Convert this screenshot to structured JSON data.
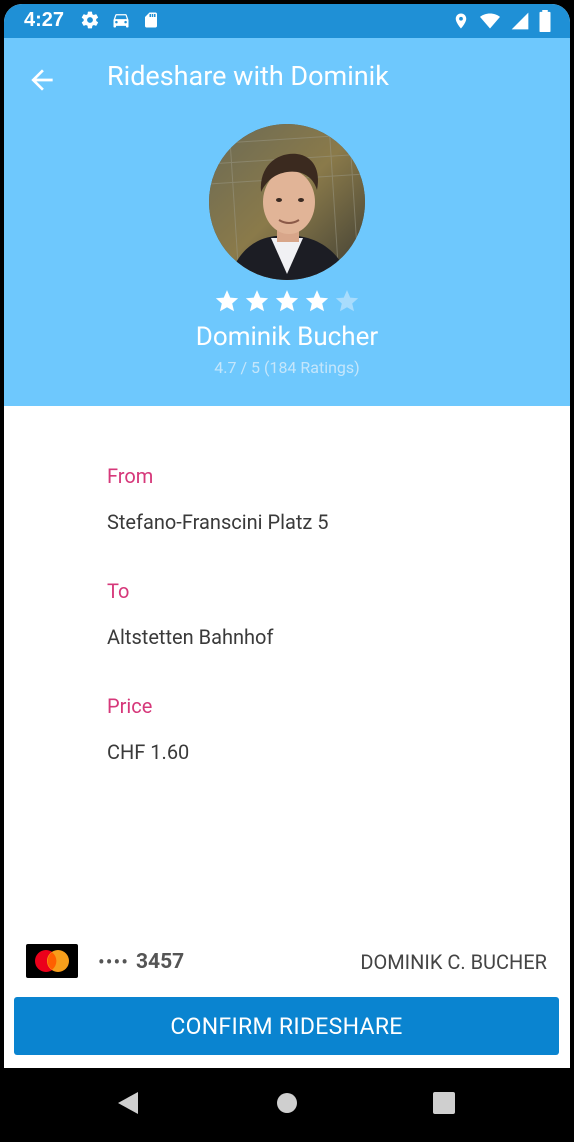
{
  "status_bar": {
    "time": "4:27",
    "icons_left": [
      "settings-icon",
      "car-icon",
      "sd-card-icon"
    ],
    "icons_right": [
      "location-icon",
      "wifi-icon",
      "signal-icon",
      "battery-icon"
    ]
  },
  "app_bar": {
    "title": "Rideshare with Dominik",
    "back_icon": "arrow-back-icon"
  },
  "driver": {
    "name": "Dominik Bucher",
    "rating_stars": 4.5,
    "rating_max": 5,
    "rating_text": "4.7 / 5 (184 Ratings)"
  },
  "details": {
    "from_label": "From",
    "from_value": "Stefano-Franscini Platz 5",
    "to_label": "To",
    "to_value": "Altstetten Bahnhof",
    "price_label": "Price",
    "price_value": "CHF 1.60"
  },
  "payment": {
    "card_brand_icon": "mastercard-icon",
    "card_dots": "••••",
    "card_last4": "3457",
    "card_holder": "DOMINIK C. BUCHER"
  },
  "confirm_button": {
    "label": "CONFIRM RIDESHARE"
  },
  "nav_bar": {
    "buttons": [
      "back-nav-icon",
      "home-nav-icon",
      "recents-nav-icon"
    ]
  },
  "colors": {
    "status_bar": "#1f90d6",
    "app_bar": "#6ec8fd",
    "label_accent": "#d6387a",
    "button": "#0a84d0"
  }
}
